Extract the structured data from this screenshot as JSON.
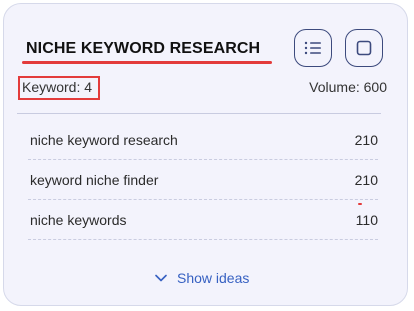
{
  "card": {
    "title": "NICHE KEYWORD RESEARCH",
    "keyword_count_label": "Keyword: 4",
    "volume_label": "Volume: 600"
  },
  "keywords": [
    {
      "keyword": "niche keyword research",
      "volume": "210"
    },
    {
      "keyword": "keyword niche finder",
      "volume": "210"
    },
    {
      "keyword": "niche keywords",
      "volume": "110"
    }
  ],
  "footer": {
    "show_ideas_label": "Show ideas"
  },
  "icons": {
    "list_button": "list-icon",
    "square_button": "square-icon",
    "show_ideas": "chevron-down-icon"
  },
  "colors": {
    "card_background": "#f3f3fc",
    "accent_red": "#e33b3b",
    "link_blue": "#3761c2",
    "icon_border": "#3c4a7d"
  }
}
